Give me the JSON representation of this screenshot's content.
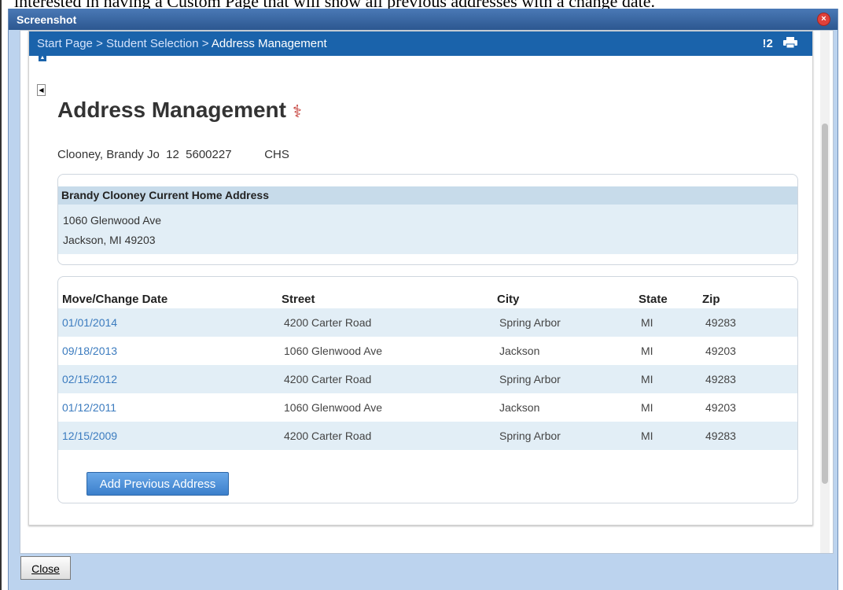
{
  "background_text": "interested in having a Custom Page that will show all previous addresses with a change date.",
  "window": {
    "title": "Screenshot",
    "close_glyph": "×"
  },
  "breadcrumb": {
    "items": [
      "Start Page",
      "Student Selection",
      "Address Management"
    ],
    "separator": ">",
    "badge": "!2"
  },
  "page": {
    "title": "Address Management",
    "title_icon": "caduceus-icon",
    "student_line": "Clooney, Brandy Jo  12  5600227          CHS"
  },
  "current_address": {
    "header": "Brandy Clooney Current Home Address",
    "line1": "1060 Glenwood Ave",
    "line2": "Jackson, MI 49203"
  },
  "history": {
    "columns": [
      "Move/Change Date",
      "Street",
      "City",
      "State",
      "Zip"
    ],
    "rows": [
      {
        "date": "01/01/2014",
        "street": "4200 Carter Road",
        "city": "Spring Arbor",
        "state": "MI",
        "zip": "49283"
      },
      {
        "date": "09/18/2013",
        "street": "1060 Glenwood Ave",
        "city": "Jackson",
        "state": "MI",
        "zip": "49203"
      },
      {
        "date": "02/15/2012",
        "street": "4200 Carter Road",
        "city": "Spring Arbor",
        "state": "MI",
        "zip": "49283"
      },
      {
        "date": "01/12/2011",
        "street": "1060 Glenwood Ave",
        "city": "Jackson",
        "state": "MI",
        "zip": "49203"
      },
      {
        "date": "12/15/2009",
        "street": "4200 Carter Road",
        "city": "Spring Arbor",
        "state": "MI",
        "zip": "49283"
      }
    ],
    "add_button": "Add Previous Address"
  },
  "footer": {
    "close_button": "Close"
  },
  "colors": {
    "breadcrumb_bar": "#1a63ab",
    "title_bar": "#2c5790",
    "dialog_bg": "#bcd3ee",
    "row_alt": "#e2eef6",
    "link": "#3b7bbf",
    "button": "#3b7fcb"
  }
}
